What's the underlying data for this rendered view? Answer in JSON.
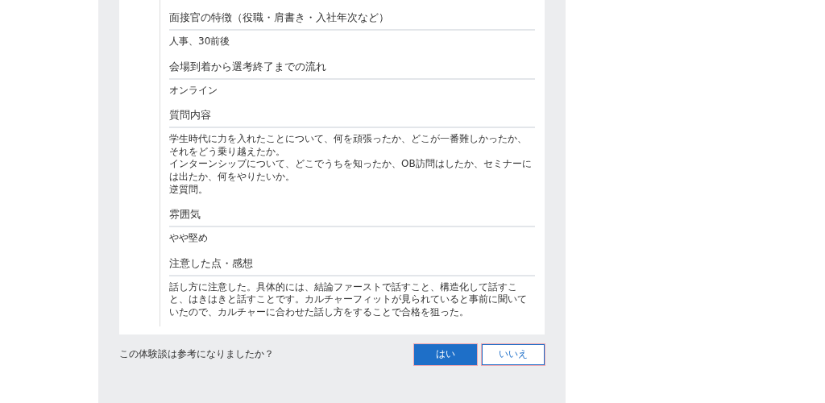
{
  "sections": [
    {
      "heading": "面接官の特徴（役職・肩書き・入社年次など）",
      "body": [
        "人事、30前後"
      ]
    },
    {
      "heading": "会場到着から選考終了までの流れ",
      "body": [
        "オンライン"
      ]
    },
    {
      "heading": "質問内容",
      "body": [
        "学生時代に力を入れたことについて、何を頑張ったか、どこが一番難しかったか、それをどう乗り越えたか。",
        "インターンシップについて、どこでうちを知ったか、OB訪問はしたか、セミナーには出たか、何をやりたいか。",
        "逆質問。"
      ]
    },
    {
      "heading": "雰囲気",
      "body": [
        "やや堅め"
      ]
    },
    {
      "heading": "注意した点・感想",
      "body": [
        "話し方に注意した。具体的には、結論ファーストで話すこと、構造化して話すこと、はきはきと話すことです。カルチャーフィットが見られていると事前に聞いていたので、カルチャーに合わせた話し方をすることで合格を狙った。"
      ]
    }
  ],
  "feedback": {
    "question": "この体験談は参考になりましたか？",
    "buttons": [
      {
        "label": "はい",
        "kind": "primary"
      },
      {
        "label": "いいえ",
        "kind": "secondary"
      }
    ]
  }
}
